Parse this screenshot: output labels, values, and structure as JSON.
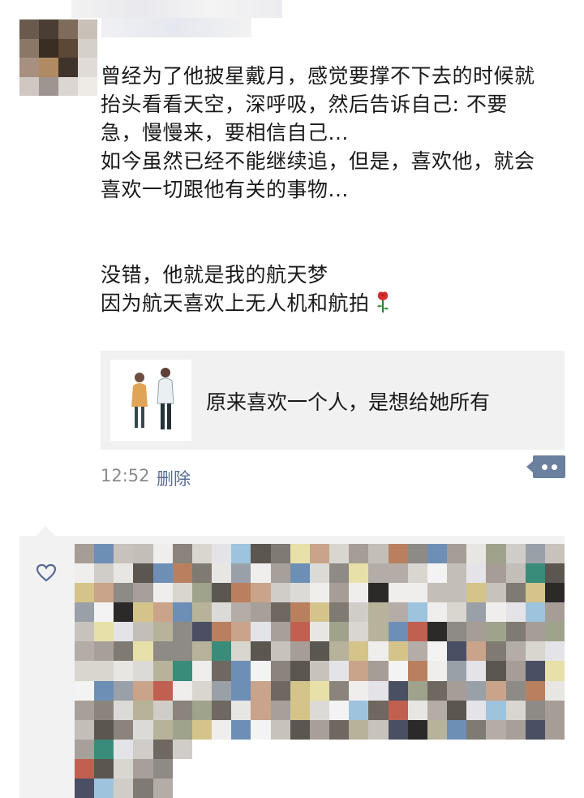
{
  "post": {
    "lines": [
      "曾经为了他披星戴月，感觉要撑不下去的时候就",
      "抬头看看天空，深呼吸，然后告诉自己: 不要",
      "急，慢慢来，要相信自己...",
      "如今虽然已经不能继续追，但是，喜欢他，就会",
      "喜欢一切跟他有关的事物..."
    ],
    "lines2": [
      "没错，他就是我的航天梦",
      "因为航天喜欢上无人机和航拍"
    ],
    "emoji_icon": "rose-icon"
  },
  "link_card": {
    "title": "原来喜欢一个人，是想给她所有",
    "thumb_icon": "couple-illustration"
  },
  "meta": {
    "time": "12:52",
    "delete_label": "删除"
  },
  "icons": {
    "more": "more-dots-icon",
    "like": "heart-icon"
  },
  "colors": {
    "link_blue": "#576b95",
    "more_button": "#6b7f9e",
    "card_bg": "#f1f1f1"
  }
}
